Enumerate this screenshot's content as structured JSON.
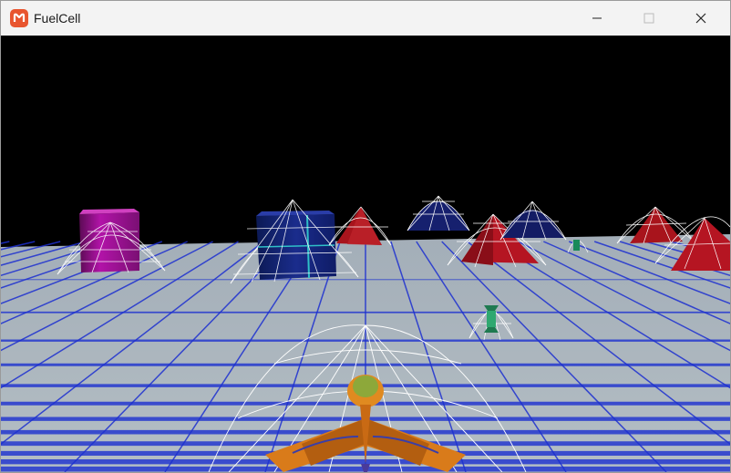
{
  "window": {
    "title": "FuelCell",
    "app_icon": "monogame-logo-icon",
    "controls": [
      "minimize-icon",
      "maximize-icon",
      "close-icon"
    ]
  },
  "scene": {
    "sky_color": "#000000",
    "ground_color": "#a9b4bc",
    "grid_color": "#1c2fd0",
    "objects": [
      "magenta-crate",
      "blue-crate",
      "red-pyramid",
      "blue-dome",
      "red-pyramid",
      "blue-dome",
      "red-pyramid",
      "red-pyramid",
      "green-fuel-cell",
      "green-fuel-cell",
      "orange-player-ship"
    ]
  }
}
